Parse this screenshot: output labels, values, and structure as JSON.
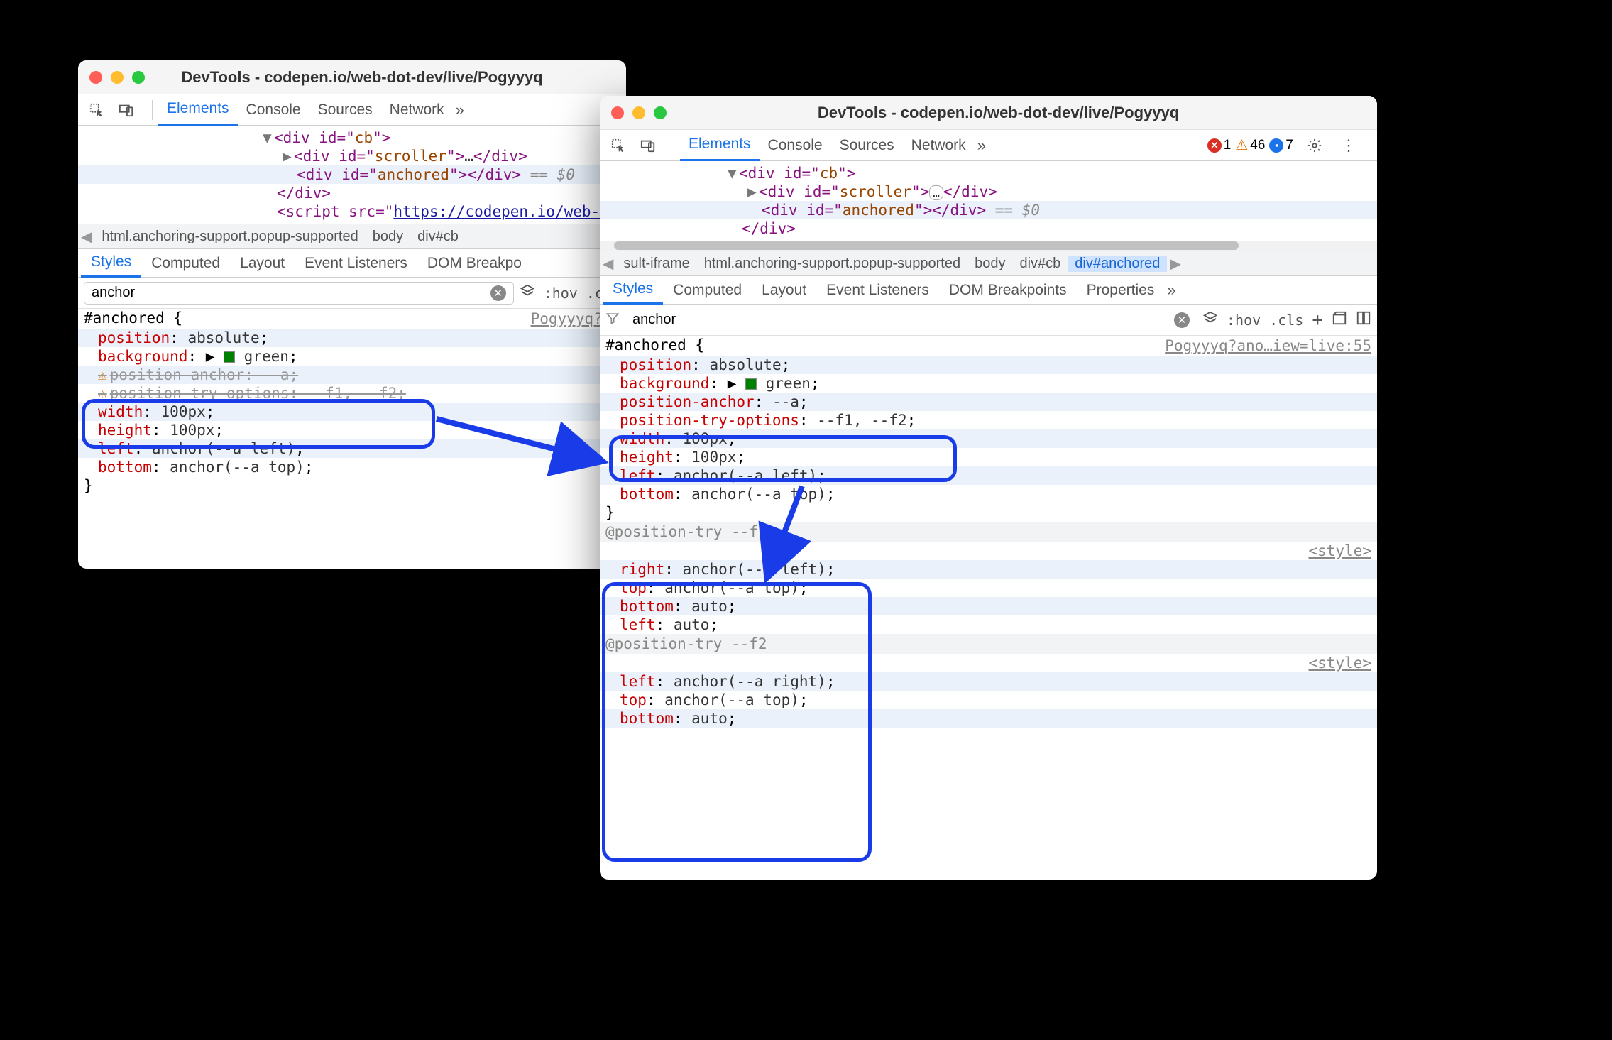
{
  "window1": {
    "title": "DevTools - codepen.io/web-dot-dev/live/Pogyyyq",
    "tabs": [
      "Elements",
      "Console",
      "Sources",
      "Network"
    ],
    "activeTab": "Elements",
    "more": "»",
    "dom": {
      "line1a": "<div id=\"",
      "line1b": "cb",
      "line1c": "\">",
      "line2a": "<div id=\"",
      "line2b": "scroller",
      "line2c": "\">",
      "line2d": "…",
      "line2e": "</div>",
      "line3a": "<div id=\"",
      "line3b": "anchored",
      "line3c": "\"></div>",
      "line3d": " == $0",
      "line4": "</div>",
      "line5a": "<script src=\"",
      "line5b": "https://codepen.io/web-dot-d"
    },
    "crumbs": [
      "html.anchoring-support.popup-supported",
      "body",
      "div#cb"
    ],
    "subtabs": [
      "Styles",
      "Computed",
      "Layout",
      "Event Listeners",
      "DOM Breakpo"
    ],
    "filter": "anchor",
    "hov": ":hov",
    "cls": ".cls",
    "source": "Pogyyyq?an",
    "rule": {
      "selector": "#anchored {",
      "p1n": "position",
      "p1v": "absolute",
      "p2n": "background",
      "p2v": "green",
      "p3n": "position-anchor",
      "p3v": "--a",
      "p4n": "position-try-options",
      "p4v": "--f1, --f2",
      "p5n": "width",
      "p5v": "100px",
      "p6n": "height",
      "p6v": "100px",
      "p7n": "left",
      "p7v": "anchor(--a left)",
      "p8n": "bottom",
      "p8v": "anchor(--a top)",
      "close": "}"
    }
  },
  "window2": {
    "title": "DevTools - codepen.io/web-dot-dev/live/Pogyyyq",
    "tabs": [
      "Elements",
      "Console",
      "Sources",
      "Network"
    ],
    "activeTab": "Elements",
    "more": "»",
    "errors": "1",
    "warnings": "46",
    "issues": "7",
    "dom": {
      "line1a": "<div id=\"",
      "line1b": "cb",
      "line1c": "\">",
      "line2a": "<div id=\"",
      "line2b": "scroller",
      "line2c": "\">",
      "line2d": "…",
      "line2e": "</div>",
      "line3a": "<div id=\"",
      "line3b": "anchored",
      "line3c": "\"></div>",
      "line3d": " == $0",
      "line4": "</div>"
    },
    "crumbs": [
      "sult-iframe",
      "html.anchoring-support.popup-supported",
      "body",
      "div#cb",
      "div#anchored"
    ],
    "subtabs": [
      "Styles",
      "Computed",
      "Layout",
      "Event Listeners",
      "DOM Breakpoints",
      "Properties"
    ],
    "filter": "anchor",
    "hov": ":hov",
    "cls": ".cls",
    "source": "Pogyyyq?ano…iew=live:55",
    "rule": {
      "selector": "#anchored {",
      "p1n": "position",
      "p1v": "absolute",
      "p2n": "background",
      "p2v": "green",
      "p3n": "position-anchor",
      "p3v": "--a",
      "p4n": "position-try-options",
      "p4v": "--f1, --f2",
      "p5n": "width",
      "p5v": "100px",
      "p6n": "height",
      "p6v": "100px",
      "p7n": "left",
      "p7v": "anchor(--a left)",
      "p8n": "bottom",
      "p8v": "anchor(--a top)",
      "close": "}"
    },
    "try1": {
      "rule": "@position-try --f1",
      "src": "<style>",
      "p1n": "right",
      "p1v": "anchor(--a left)",
      "p2n": "top",
      "p2v": "anchor(--a top)",
      "p3n": "bottom",
      "p3v": "auto",
      "p4n": "left",
      "p4v": "auto"
    },
    "try2": {
      "rule": "@position-try --f2",
      "src": "<style>",
      "p1n": "left",
      "p1v": "anchor(--a right)",
      "p2n": "top",
      "p2v": "anchor(--a top)",
      "p3n": "bottom",
      "p3v": "auto"
    }
  }
}
